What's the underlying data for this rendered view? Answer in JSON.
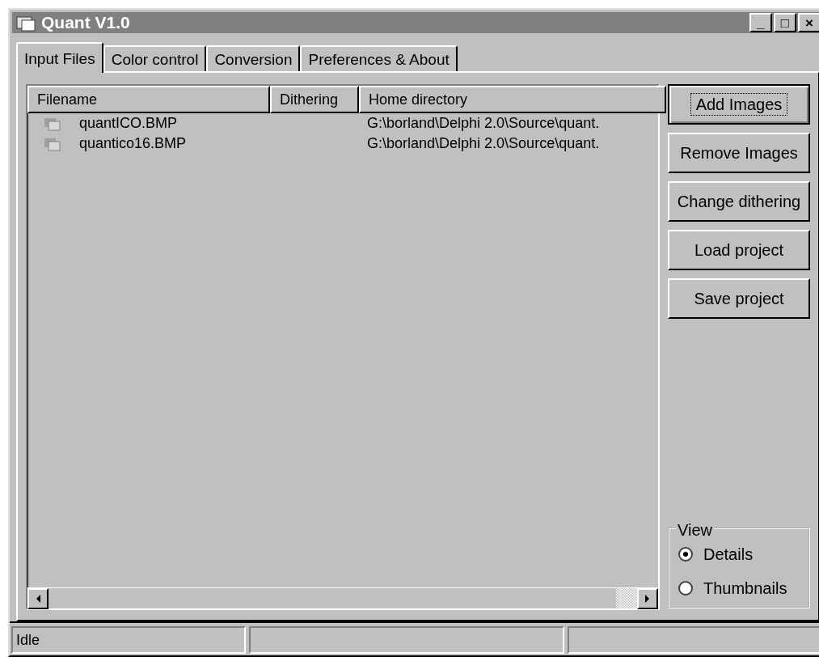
{
  "window": {
    "title": "Quant V1.0",
    "controls": [
      "_",
      "□",
      "×"
    ]
  },
  "tabs": [
    {
      "label": "Input Files",
      "selected": true
    },
    {
      "label": "Color control",
      "selected": false
    },
    {
      "label": "Conversion",
      "selected": false
    },
    {
      "label": "Preferences & About",
      "selected": false
    }
  ],
  "table": {
    "columns": [
      "Filename",
      "Dithering",
      "Home directory"
    ],
    "rows": [
      {
        "cells": [
          "quantICO.BMP",
          "",
          "G:\\borland\\Delphi 2.0\\Source\\quant."
        ]
      },
      {
        "cells": [
          "quantico16.BMP",
          "",
          "G:\\borland\\Delphi 2.0\\Source\\quant."
        ]
      }
    ]
  },
  "buttons": [
    {
      "label": "Add Images",
      "focused": true
    },
    {
      "label": "Remove Images",
      "focused": false
    },
    {
      "label": "Change dithering",
      "focused": false
    },
    {
      "label": "Load project",
      "focused": false
    },
    {
      "label": "Save project",
      "focused": false
    }
  ],
  "view_group": {
    "title": "View",
    "options": [
      {
        "label": "Details",
        "selected": true
      },
      {
        "label": "Thumbnails",
        "selected": false
      }
    ]
  },
  "status_bar": {
    "panels": [
      "Idle"
    ]
  }
}
